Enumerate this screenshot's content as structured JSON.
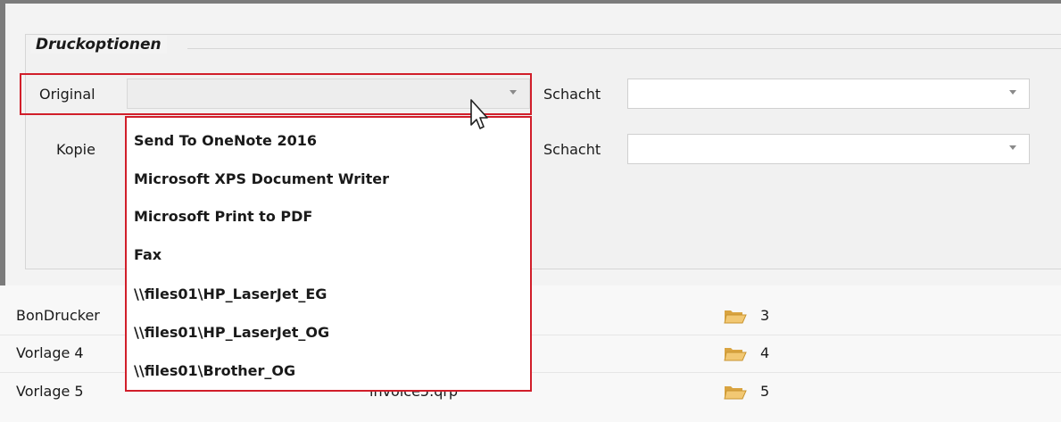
{
  "group": {
    "title": "Druckoptionen"
  },
  "original": {
    "label": "Original",
    "value": "",
    "schacht_label": "Schacht",
    "schacht_value": ""
  },
  "kopie": {
    "label": "Kopie",
    "schacht_label": "Schacht",
    "schacht_value": ""
  },
  "dropdown": {
    "options": [
      "Send To OneNote 2016",
      "Microsoft XPS Document Writer",
      "Microsoft Print to PDF",
      "Fax",
      "\\\\files01\\HP_LaserJet_EG",
      "\\\\files01\\HP_LaserJet_OG",
      "\\\\files01\\Brother_OG"
    ]
  },
  "rows": [
    {
      "name": "BonDrucker",
      "file": "",
      "folder_number": "3"
    },
    {
      "name": "Vorlage 4",
      "file": "",
      "folder_number": "4"
    },
    {
      "name": "Vorlage 5",
      "file": "invoice5.qrp",
      "folder_number": "5"
    }
  ],
  "icons": {
    "folder": "folder-open-icon",
    "cursor": "mouse-pointer-icon"
  },
  "colors": {
    "highlight": "#d11e2a",
    "folder": "#e8b85a"
  }
}
